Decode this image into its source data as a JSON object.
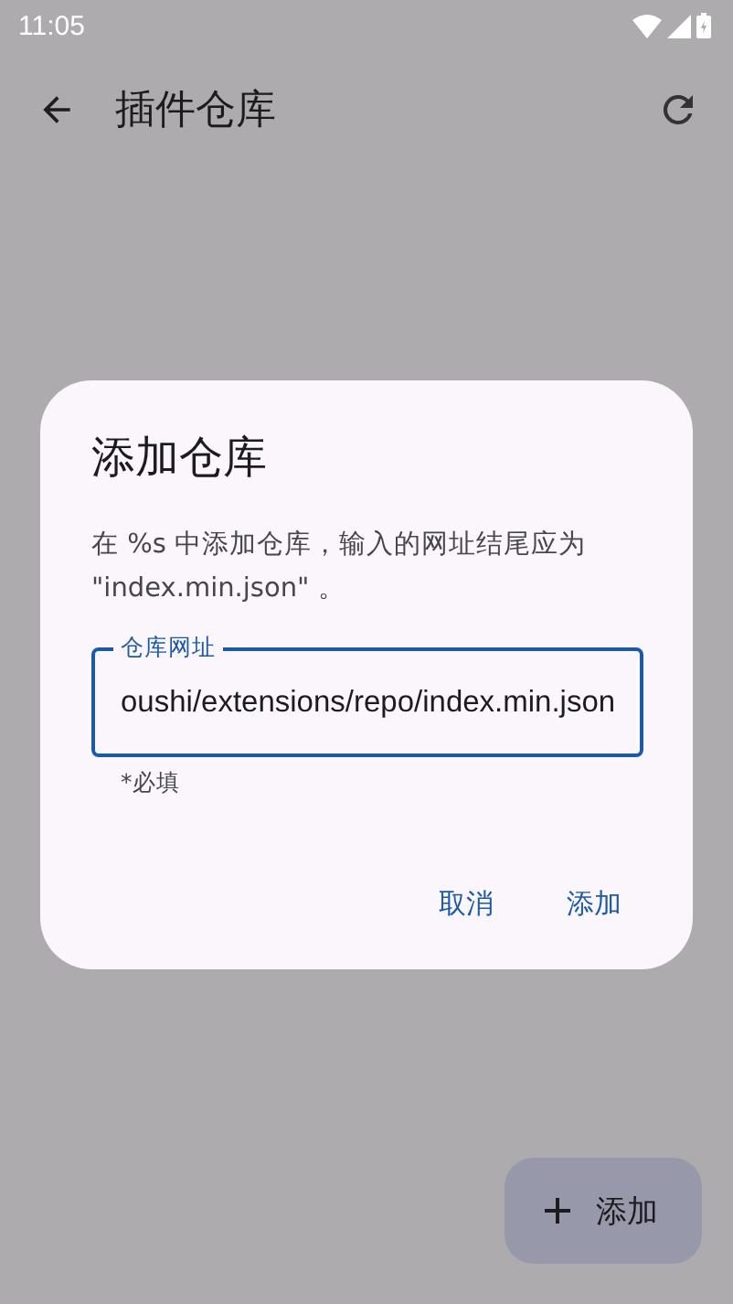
{
  "status_bar": {
    "time": "11:05"
  },
  "app_bar": {
    "title": "插件仓库"
  },
  "dialog": {
    "title": "添加仓库",
    "message": "在 %s 中添加仓库，输入的网址结尾应为 \"index.min.json\" 。",
    "field": {
      "label": "仓库网址",
      "value": "oushi/extensions/repo/index.min.json",
      "helper": "*必填"
    },
    "buttons": [
      {
        "label": "取消"
      },
      {
        "label": "添加"
      }
    ]
  },
  "fab": {
    "label": "添加"
  }
}
